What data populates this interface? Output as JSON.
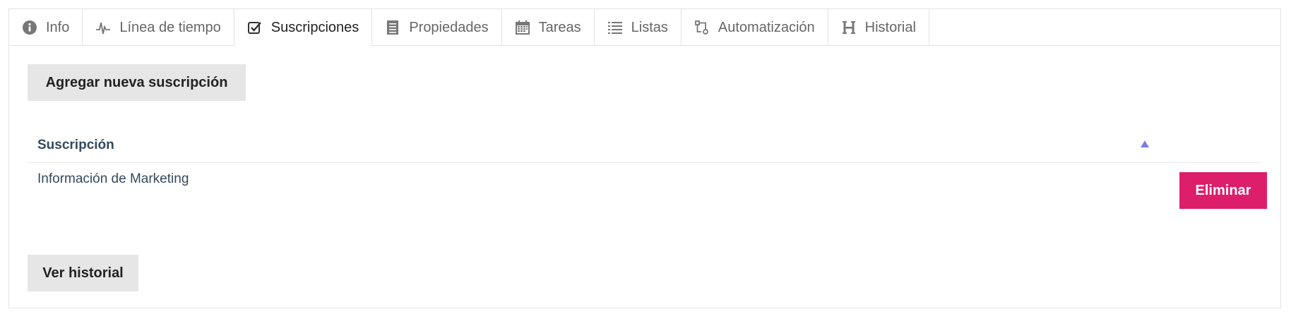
{
  "tabs": [
    {
      "label": "Info",
      "icon": "info-icon",
      "active": false
    },
    {
      "label": "Línea de tiempo",
      "icon": "pulse-icon",
      "active": false
    },
    {
      "label": "Suscripciones",
      "icon": "checkbox-icon",
      "active": true
    },
    {
      "label": "Propiedades",
      "icon": "document-icon",
      "active": false
    },
    {
      "label": "Tareas",
      "icon": "calendar-icon",
      "active": false
    },
    {
      "label": "Listas",
      "icon": "list-icon",
      "active": false
    },
    {
      "label": "Automatización",
      "icon": "workflow-icon",
      "active": false
    },
    {
      "label": "Historial",
      "icon": "header-h-icon",
      "active": false
    }
  ],
  "actions": {
    "add_label": "Agregar nueva suscripción",
    "history_label": "Ver historial"
  },
  "table": {
    "header": "Suscripción",
    "rows": [
      {
        "name": "Información de Marketing",
        "delete_label": "Eliminar"
      }
    ]
  },
  "colors": {
    "accent_delete": "#dd1e6a",
    "sort_indicator": "#7b7ee0",
    "button_gray": "#e6e6e6",
    "header_text": "#34495e"
  }
}
